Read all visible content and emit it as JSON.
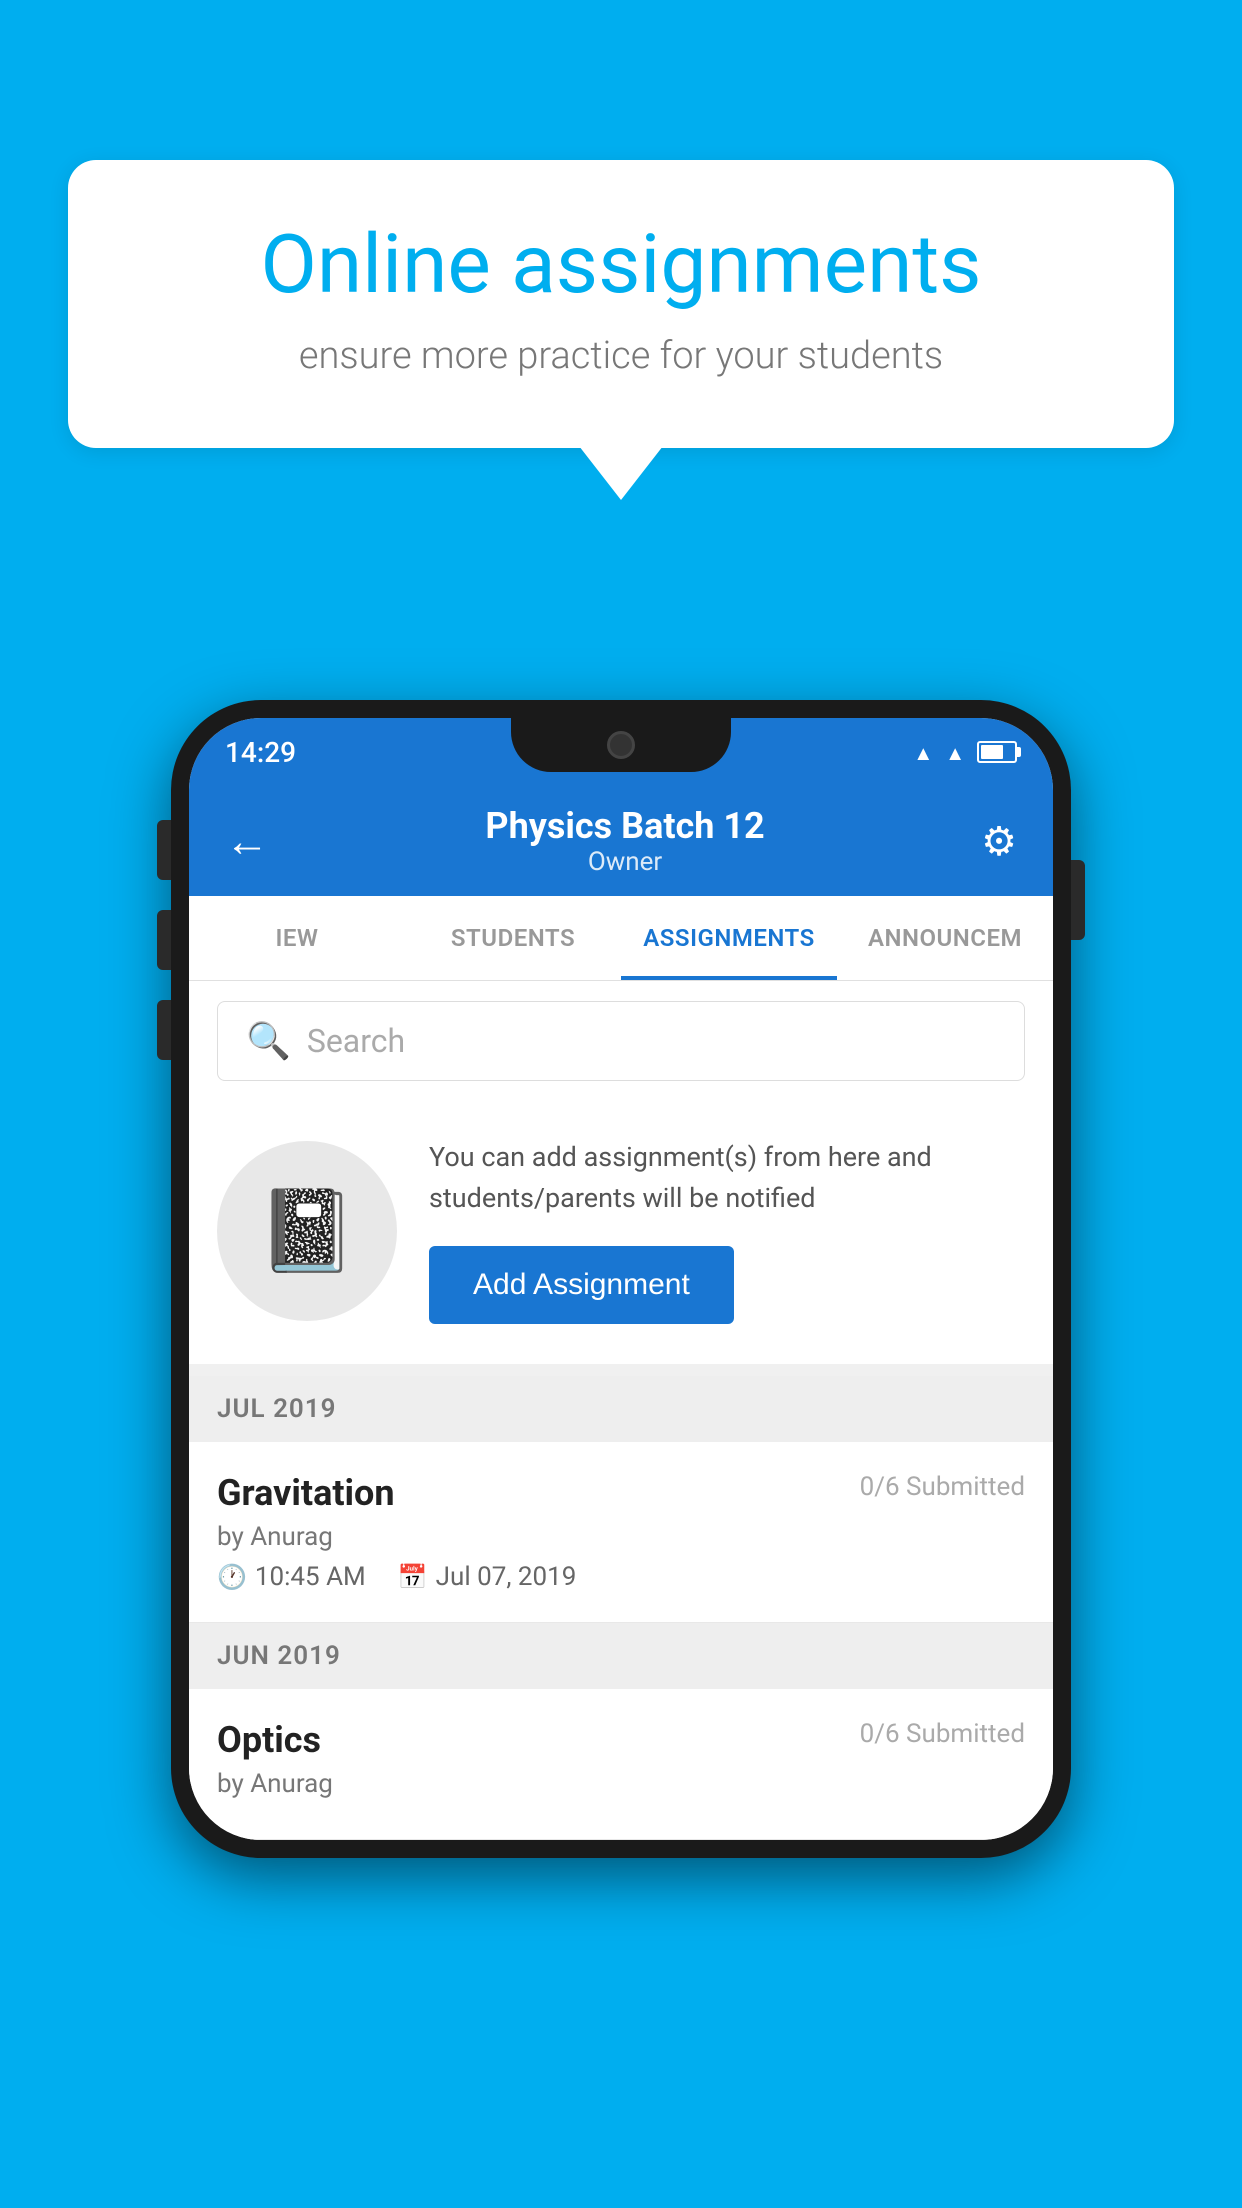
{
  "background_color": "#00AEEF",
  "speech_bubble": {
    "title": "Online assignments",
    "subtitle": "ensure more practice for your students"
  },
  "status_bar": {
    "time": "14:29"
  },
  "app_bar": {
    "title": "Physics Batch 12",
    "subtitle": "Owner",
    "back_label": "←",
    "settings_label": "⚙"
  },
  "tabs": [
    {
      "label": "IEW",
      "active": false
    },
    {
      "label": "STUDENTS",
      "active": false
    },
    {
      "label": "ASSIGNMENTS",
      "active": true
    },
    {
      "label": "ANNOUNCEM",
      "active": false
    }
  ],
  "search": {
    "placeholder": "Search"
  },
  "info_section": {
    "description": "You can add assignment(s) from here and students/parents will be notified",
    "add_button_label": "Add Assignment"
  },
  "assignment_sections": [
    {
      "month_label": "JUL 2019",
      "assignments": [
        {
          "name": "Gravitation",
          "submitted": "0/6 Submitted",
          "author": "by Anurag",
          "time": "10:45 AM",
          "date": "Jul 07, 2019"
        }
      ]
    },
    {
      "month_label": "JUN 2019",
      "assignments": [
        {
          "name": "Optics",
          "submitted": "0/6 Submitted",
          "author": "by Anurag",
          "time": "",
          "date": ""
        }
      ]
    }
  ]
}
